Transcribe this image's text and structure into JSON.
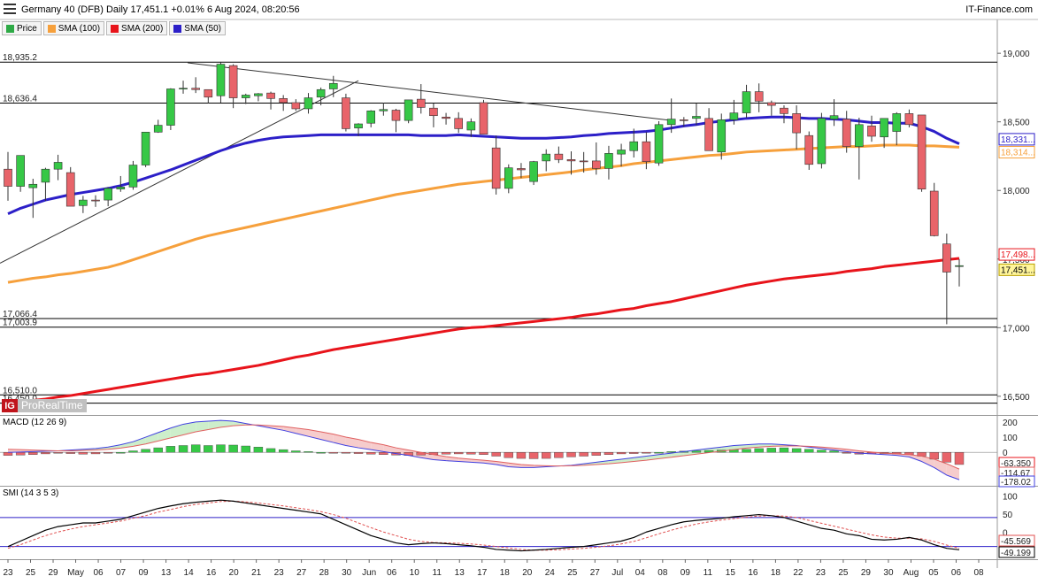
{
  "header": {
    "title": "Germany 40 (DFB) Daily 17,451.1 +0.01% 6 Aug 2024, 08:20:56",
    "brand": "IT-Finance.com"
  },
  "legend": [
    {
      "label": "Price",
      "color": "#2eaa46"
    },
    {
      "label": "SMA (100)",
      "color": "#f6a03c"
    },
    {
      "label": "SMA (200)",
      "color": "#e8141b"
    },
    {
      "label": "SMA (50)",
      "color": "#2c1fc8"
    }
  ],
  "logo": {
    "mark": "IG",
    "text": "ProRealTime"
  },
  "colors": {
    "up": "#36c846",
    "down": "#e8646a",
    "sma50": "#2c1fc8",
    "sma100": "#f6a03c",
    "sma200": "#e8141b",
    "macd": "#4040e0",
    "signal": "#e06060",
    "smi": "#000000",
    "smi_signal": "#e05050"
  },
  "chart_data": [
    {
      "type": "candlestick",
      "title": "Germany 40 (DFB) Daily",
      "ylim": [
        16370,
        19130
      ],
      "y_ticks": [
        "19,000",
        "18,500",
        "18,000",
        "17,500",
        "17,000",
        "16,500"
      ],
      "x_ticks": [
        "23",
        "25",
        "29",
        "May",
        "06",
        "07",
        "09",
        "13",
        "14",
        "16",
        "20",
        "21",
        "23",
        "27",
        "28",
        "30",
        "Jun",
        "06",
        "10",
        "11",
        "13",
        "17",
        "18",
        "20",
        "24",
        "25",
        "27",
        "Jul",
        "04",
        "08",
        "09",
        "11",
        "15",
        "16",
        "18",
        "22",
        "23",
        "25",
        "29",
        "30",
        "Aug",
        "05",
        "06",
        "08"
      ],
      "horizontal_levels": [
        {
          "label": "18,935.2",
          "value": 18935.2
        },
        {
          "label": "18,636.4",
          "value": 18636.4
        },
        {
          "label": "17,066.4",
          "value": 17066.4
        },
        {
          "label": "17,003.9",
          "value": 17003.9
        },
        {
          "label": "16,510.0",
          "value": 16510.0
        },
        {
          "label": "16,450.0",
          "value": 16450.0
        }
      ],
      "price_tags": [
        {
          "label": "18,331...",
          "value": 18331,
          "series": "SMA (50)"
        },
        {
          "label": "18,314...",
          "value": 18314,
          "series": "SMA (100)"
        },
        {
          "label": "17,498...",
          "value": 17498,
          "series": "SMA (200)"
        },
        {
          "label": "17,451...",
          "value": 17451,
          "series": "Price"
        }
      ],
      "trendlines": [
        {
          "from": [
            0,
            17470
          ],
          "to": [
            28,
            18800
          ]
        },
        {
          "from": [
            15,
            18930
          ],
          "to": [
            53,
            18510
          ]
        }
      ],
      "candles": [
        [
          18155,
          18280,
          17925,
          18030
        ],
        [
          18030,
          18245,
          17990,
          18255
        ],
        [
          18020,
          18085,
          17800,
          18045
        ],
        [
          18060,
          18165,
          17925,
          18155
        ],
        [
          18155,
          18260,
          18075,
          18205
        ],
        [
          18130,
          18170,
          17955,
          17885
        ],
        [
          17890,
          17960,
          17835,
          17930
        ],
        [
          17930,
          17965,
          17880,
          17925
        ],
        [
          17930,
          18025,
          17885,
          18015
        ],
        [
          18010,
          18105,
          17990,
          18025
        ],
        [
          18025,
          18215,
          18005,
          18185
        ],
        [
          18185,
          18425,
          18170,
          18425
        ],
        [
          18425,
          18515,
          18420,
          18475
        ],
        [
          18475,
          18745,
          18440,
          18740
        ],
        [
          18740,
          18800,
          18705,
          18745
        ],
        [
          18745,
          18825,
          18710,
          18735
        ],
        [
          18735,
          18730,
          18635,
          18680
        ],
        [
          18690,
          18935,
          18640,
          18920
        ],
        [
          18910,
          18920,
          18600,
          18675
        ],
        [
          18675,
          18705,
          18630,
          18695
        ],
        [
          18690,
          18710,
          18650,
          18705
        ],
        [
          18710,
          18720,
          18590,
          18670
        ],
        [
          18670,
          18695,
          18580,
          18640
        ],
        [
          18640,
          18665,
          18580,
          18595
        ],
        [
          18595,
          18710,
          18560,
          18675
        ],
        [
          18680,
          18750,
          18620,
          18735
        ],
        [
          18740,
          18835,
          18680,
          18780
        ],
        [
          18675,
          18705,
          18430,
          18450
        ],
        [
          18455,
          18490,
          18395,
          18485
        ],
        [
          18490,
          18585,
          18460,
          18580
        ],
        [
          18580,
          18640,
          18545,
          18590
        ],
        [
          18585,
          18595,
          18425,
          18510
        ],
        [
          18510,
          18625,
          18490,
          18660
        ],
        [
          18665,
          18775,
          18560,
          18605
        ],
        [
          18600,
          18635,
          18460,
          18545
        ],
        [
          18535,
          18565,
          18480,
          18525
        ],
        [
          18525,
          18570,
          18420,
          18450
        ],
        [
          18440,
          18525,
          18390,
          18500
        ],
        [
          18640,
          18660,
          18440,
          18410
        ],
        [
          18310,
          18400,
          17970,
          18015
        ],
        [
          18015,
          18190,
          17980,
          18165
        ],
        [
          18160,
          18200,
          18090,
          18150
        ],
        [
          18065,
          18215,
          18040,
          18210
        ],
        [
          18215,
          18300,
          18140,
          18265
        ],
        [
          18265,
          18320,
          18200,
          18225
        ],
        [
          18225,
          18285,
          18115,
          18215
        ],
        [
          18215,
          18280,
          18130,
          18210
        ],
        [
          18215,
          18350,
          18115,
          18160
        ],
        [
          18160,
          18325,
          18080,
          18270
        ],
        [
          18265,
          18340,
          18175,
          18295
        ],
        [
          18290,
          18450,
          18240,
          18355
        ],
        [
          18355,
          18425,
          18155,
          18210
        ],
        [
          18200,
          18505,
          18180,
          18480
        ],
        [
          18480,
          18670,
          18420,
          18520
        ],
        [
          18515,
          18535,
          18465,
          18510
        ],
        [
          18525,
          18635,
          18475,
          18540
        ],
        [
          18525,
          18600,
          18320,
          18290
        ],
        [
          18280,
          18560,
          18225,
          18515
        ],
        [
          18515,
          18660,
          18480,
          18565
        ],
        [
          18565,
          18770,
          18530,
          18720
        ],
        [
          18720,
          18780,
          18570,
          18650
        ],
        [
          18640,
          18655,
          18545,
          18620
        ],
        [
          18600,
          18620,
          18490,
          18560
        ],
        [
          18560,
          18620,
          18300,
          18420
        ],
        [
          18400,
          18430,
          18150,
          18190
        ],
        [
          18195,
          18565,
          18160,
          18525
        ],
        [
          18520,
          18665,
          18470,
          18545
        ],
        [
          18520,
          18580,
          18275,
          18320
        ],
        [
          18320,
          18530,
          18080,
          18480
        ],
        [
          18470,
          18545,
          18355,
          18395
        ],
        [
          18390,
          18490,
          18310,
          18525
        ],
        [
          18430,
          18570,
          18330,
          18560
        ],
        [
          18560,
          18590,
          18460,
          18480
        ],
        [
          18550,
          18520,
          17990,
          18010
        ],
        [
          17995,
          18055,
          17665,
          17670
        ],
        [
          17610,
          17685,
          17025,
          17405
        ],
        [
          17450,
          17500,
          17300,
          17452
        ]
      ],
      "sma50": [
        17830,
        17870,
        17900,
        17930,
        17950,
        17970,
        17985,
        18000,
        18015,
        18035,
        18060,
        18090,
        18120,
        18150,
        18185,
        18220,
        18255,
        18290,
        18320,
        18345,
        18365,
        18380,
        18390,
        18395,
        18400,
        18405,
        18405,
        18405,
        18405,
        18405,
        18405,
        18405,
        18405,
        18400,
        18400,
        18400,
        18405,
        18400,
        18395,
        18390,
        18385,
        18380,
        18380,
        18380,
        18385,
        18390,
        18400,
        18405,
        18415,
        18420,
        18425,
        18430,
        18440,
        18455,
        18470,
        18480,
        18495,
        18505,
        18515,
        18525,
        18530,
        18535,
        18535,
        18530,
        18525,
        18525,
        18520,
        18515,
        18505,
        18495,
        18495,
        18490,
        18490,
        18465,
        18430,
        18380,
        18340
      ],
      "sma100": [
        17330,
        17345,
        17360,
        17370,
        17385,
        17395,
        17410,
        17425,
        17440,
        17465,
        17495,
        17525,
        17555,
        17585,
        17615,
        17645,
        17670,
        17690,
        17710,
        17730,
        17750,
        17770,
        17790,
        17810,
        17830,
        17850,
        17870,
        17890,
        17910,
        17930,
        17950,
        17970,
        17985,
        18000,
        18015,
        18030,
        18045,
        18055,
        18065,
        18075,
        18085,
        18095,
        18105,
        18115,
        18125,
        18135,
        18150,
        18160,
        18170,
        18180,
        18195,
        18205,
        18215,
        18225,
        18235,
        18245,
        18255,
        18260,
        18270,
        18280,
        18285,
        18290,
        18295,
        18300,
        18305,
        18310,
        18315,
        18320,
        18320,
        18325,
        18330,
        18330,
        18330,
        18325,
        18325,
        18320,
        18315
      ],
      "sma200": [
        16445,
        16460,
        16470,
        16480,
        16495,
        16505,
        16520,
        16535,
        16550,
        16565,
        16580,
        16595,
        16610,
        16625,
        16640,
        16655,
        16665,
        16680,
        16695,
        16710,
        16725,
        16745,
        16765,
        16785,
        16800,
        16820,
        16840,
        16855,
        16870,
        16885,
        16900,
        16915,
        16930,
        16945,
        16960,
        16975,
        16990,
        17000,
        17005,
        17015,
        17025,
        17035,
        17045,
        17055,
        17065,
        17075,
        17090,
        17100,
        17115,
        17130,
        17140,
        17160,
        17175,
        17190,
        17210,
        17230,
        17250,
        17270,
        17290,
        17310,
        17325,
        17340,
        17355,
        17365,
        17375,
        17385,
        17395,
        17410,
        17420,
        17430,
        17445,
        17455,
        17465,
        17475,
        17485,
        17495,
        17505
      ]
    },
    {
      "type": "bar",
      "title": "MACD (12 26 9)",
      "ylim": [
        -220,
        240
      ],
      "y_ticks": [
        "200",
        "100",
        "0"
      ],
      "value_tags": [
        {
          "label": "-63.350",
          "value": -63.35
        },
        {
          "label": "-114.67",
          "value": -114.67
        },
        {
          "label": "-178.02",
          "value": -178.02
        }
      ],
      "histogram": [
        -20,
        -18,
        -15,
        -10,
        -5,
        -8,
        -12,
        -10,
        -5,
        0,
        10,
        20,
        30,
        40,
        45,
        50,
        45,
        50,
        48,
        42,
        35,
        25,
        18,
        10,
        5,
        0,
        -3,
        -5,
        -8,
        -12,
        -15,
        -18,
        -20,
        -18,
        -15,
        -12,
        -10,
        -12,
        -15,
        -25,
        -35,
        -40,
        -42,
        -40,
        -35,
        -30,
        -25,
        -20,
        -15,
        -10,
        -8,
        -5,
        0,
        5,
        8,
        10,
        12,
        15,
        18,
        20,
        25,
        28,
        30,
        25,
        20,
        15,
        10,
        -5,
        -12,
        -10,
        -8,
        -10,
        -15,
        -25,
        -45,
        -65,
        -80
      ],
      "macd": [
        0,
        2,
        5,
        8,
        10,
        15,
        20,
        25,
        35,
        50,
        70,
        100,
        130,
        160,
        185,
        200,
        205,
        210,
        205,
        190,
        175,
        160,
        145,
        125,
        105,
        85,
        65,
        45,
        30,
        18,
        5,
        -8,
        -20,
        -35,
        -48,
        -55,
        -60,
        -65,
        -70,
        -80,
        -95,
        -100,
        -100,
        -95,
        -90,
        -85,
        -75,
        -65,
        -55,
        -45,
        -35,
        -25,
        -15,
        -5,
        5,
        15,
        25,
        35,
        45,
        50,
        55,
        55,
        50,
        45,
        35,
        25,
        15,
        5,
        -5,
        -10,
        -15,
        -20,
        -30,
        -60,
        -100,
        -150,
        -180
      ],
      "signal": [
        20,
        18,
        15,
        12,
        10,
        10,
        12,
        15,
        20,
        28,
        40,
        55,
        75,
        95,
        115,
        135,
        150,
        165,
        175,
        180,
        180,
        175,
        170,
        160,
        150,
        135,
        120,
        100,
        85,
        65,
        50,
        30,
        15,
        0,
        -15,
        -28,
        -38,
        -45,
        -52,
        -60,
        -70,
        -80,
        -85,
        -88,
        -90,
        -88,
        -85,
        -80,
        -75,
        -68,
        -60,
        -52,
        -42,
        -32,
        -22,
        -12,
        -2,
        8,
        18,
        28,
        35,
        40,
        42,
        42,
        40,
        35,
        28,
        20,
        10,
        2,
        -5,
        -10,
        -15,
        -25,
        -45,
        -75,
        -110
      ]
    },
    {
      "type": "line",
      "title": "SMI (14 3 5 3)",
      "ylim": [
        -75,
        125
      ],
      "y_ticks": [
        "100",
        "50",
        "0",
        "-50"
      ],
      "levels": [
        40,
        -40
      ],
      "value_tags": [
        {
          "label": "-45.569",
          "value": -45.569
        },
        {
          "label": "-49.199",
          "value": -49.199
        }
      ],
      "smi": [
        -40,
        -25,
        -10,
        5,
        15,
        20,
        25,
        25,
        30,
        35,
        45,
        55,
        65,
        72,
        78,
        82,
        85,
        88,
        85,
        80,
        75,
        70,
        65,
        60,
        55,
        50,
        35,
        20,
        5,
        -10,
        -20,
        -30,
        -35,
        -32,
        -30,
        -32,
        -35,
        -38,
        -42,
        -48,
        -50,
        -52,
        -50,
        -48,
        -45,
        -42,
        -40,
        -35,
        -30,
        -25,
        -15,
        0,
        10,
        20,
        28,
        32,
        35,
        38,
        42,
        45,
        48,
        45,
        40,
        30,
        20,
        10,
        5,
        -5,
        -10,
        -20,
        -22,
        -20,
        -15,
        -22,
        -35,
        -45,
        -49
      ],
      "signal": [
        -45,
        -35,
        -22,
        -10,
        0,
        8,
        15,
        20,
        25,
        30,
        38,
        45,
        55,
        62,
        70,
        76,
        80,
        84,
        85,
        83,
        80,
        76,
        72,
        67,
        62,
        56,
        48,
        38,
        25,
        12,
        0,
        -10,
        -20,
        -26,
        -29,
        -30,
        -31,
        -33,
        -36,
        -40,
        -44,
        -48,
        -50,
        -50,
        -49,
        -47,
        -45,
        -42,
        -38,
        -33,
        -26,
        -16,
        -5,
        5,
        14,
        22,
        28,
        33,
        37,
        41,
        44,
        45,
        44,
        40,
        32,
        24,
        16,
        8,
        0,
        -8,
        -14,
        -17,
        -17,
        -19,
        -26,
        -36,
        -45
      ]
    }
  ]
}
